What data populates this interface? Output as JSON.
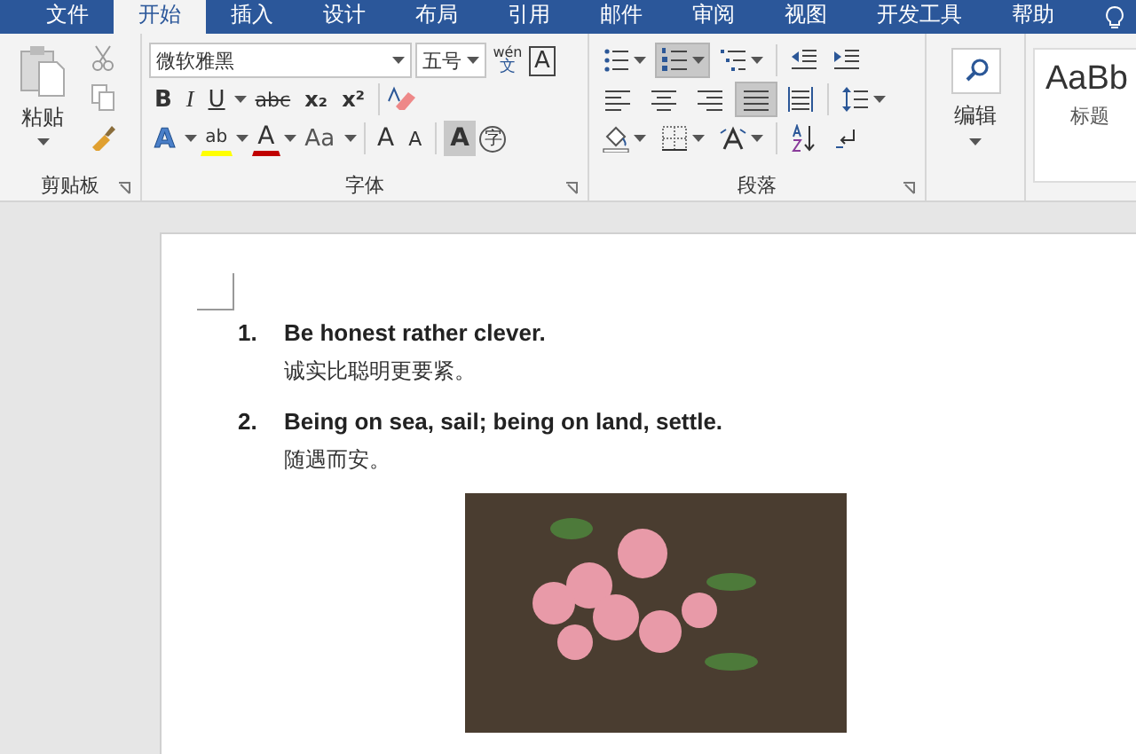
{
  "tabs": [
    {
      "label": "文件",
      "selected": false
    },
    {
      "label": "开始",
      "selected": true
    },
    {
      "label": "插入",
      "selected": false
    },
    {
      "label": "设计",
      "selected": false
    },
    {
      "label": "布局",
      "selected": false
    },
    {
      "label": "引用",
      "selected": false
    },
    {
      "label": "邮件",
      "selected": false
    },
    {
      "label": "审阅",
      "selected": false
    },
    {
      "label": "视图",
      "selected": false
    },
    {
      "label": "开发工具",
      "selected": false
    },
    {
      "label": "帮助",
      "selected": false
    }
  ],
  "clipboard": {
    "paste_label": "粘贴",
    "group_label": "剪贴板"
  },
  "font": {
    "font_name": "微软雅黑",
    "font_size": "五号",
    "phonetic_top": "wén",
    "phonetic_bottom": "文",
    "border_glyph": "A",
    "row2": [
      {
        "kind": "bold",
        "label": "B"
      },
      {
        "kind": "italic",
        "label": "I"
      },
      {
        "kind": "underline",
        "label": "U"
      },
      {
        "kind": "strike",
        "label": "abc"
      },
      {
        "kind": "sub",
        "label": "x₂"
      },
      {
        "kind": "sup",
        "label": "x²"
      }
    ],
    "row3": [
      {
        "kind": "effect",
        "label": "A"
      },
      {
        "kind": "highlight",
        "label": "ab"
      },
      {
        "kind": "color",
        "label": "A"
      },
      {
        "kind": "case",
        "label": "Aa"
      },
      {
        "kind": "grow",
        "label": "A"
      },
      {
        "kind": "shrink",
        "label": "A"
      },
      {
        "kind": "shading",
        "label": "A"
      },
      {
        "kind": "enclose",
        "label": "字"
      }
    ],
    "group_label": "字体"
  },
  "paragraph": {
    "row1": [
      {
        "kind": "bullets",
        "selected": false
      },
      {
        "kind": "numbering",
        "selected": true
      },
      {
        "kind": "multilevel",
        "selected": false
      },
      {
        "kind": "outdent",
        "selected": false
      },
      {
        "kind": "indent",
        "selected": false
      }
    ],
    "row2": [
      {
        "kind": "left",
        "selected": false
      },
      {
        "kind": "center",
        "selected": false
      },
      {
        "kind": "right",
        "selected": false
      },
      {
        "kind": "justify",
        "selected": true
      },
      {
        "kind": "distribute",
        "selected": false
      },
      {
        "kind": "spacing",
        "selected": false
      }
    ],
    "row3": [
      {
        "kind": "shade",
        "selected": false
      },
      {
        "kind": "border",
        "selected": false
      },
      {
        "kind": "asian",
        "selected": false
      },
      {
        "kind": "sort",
        "selected": false
      },
      {
        "kind": "marks",
        "selected": false
      }
    ],
    "group_label": "段落"
  },
  "editing": {
    "label": "编辑"
  },
  "styles": {
    "sample": "AaBb",
    "name": "标题"
  },
  "document": {
    "items": [
      {
        "number": "1.",
        "text": "Be honest rather clever.",
        "translation": "诚实比聪明更要紧。"
      },
      {
        "number": "2.",
        "text": "Being on sea, sail; being on land, settle.",
        "translation": "随遇而安。"
      }
    ]
  }
}
